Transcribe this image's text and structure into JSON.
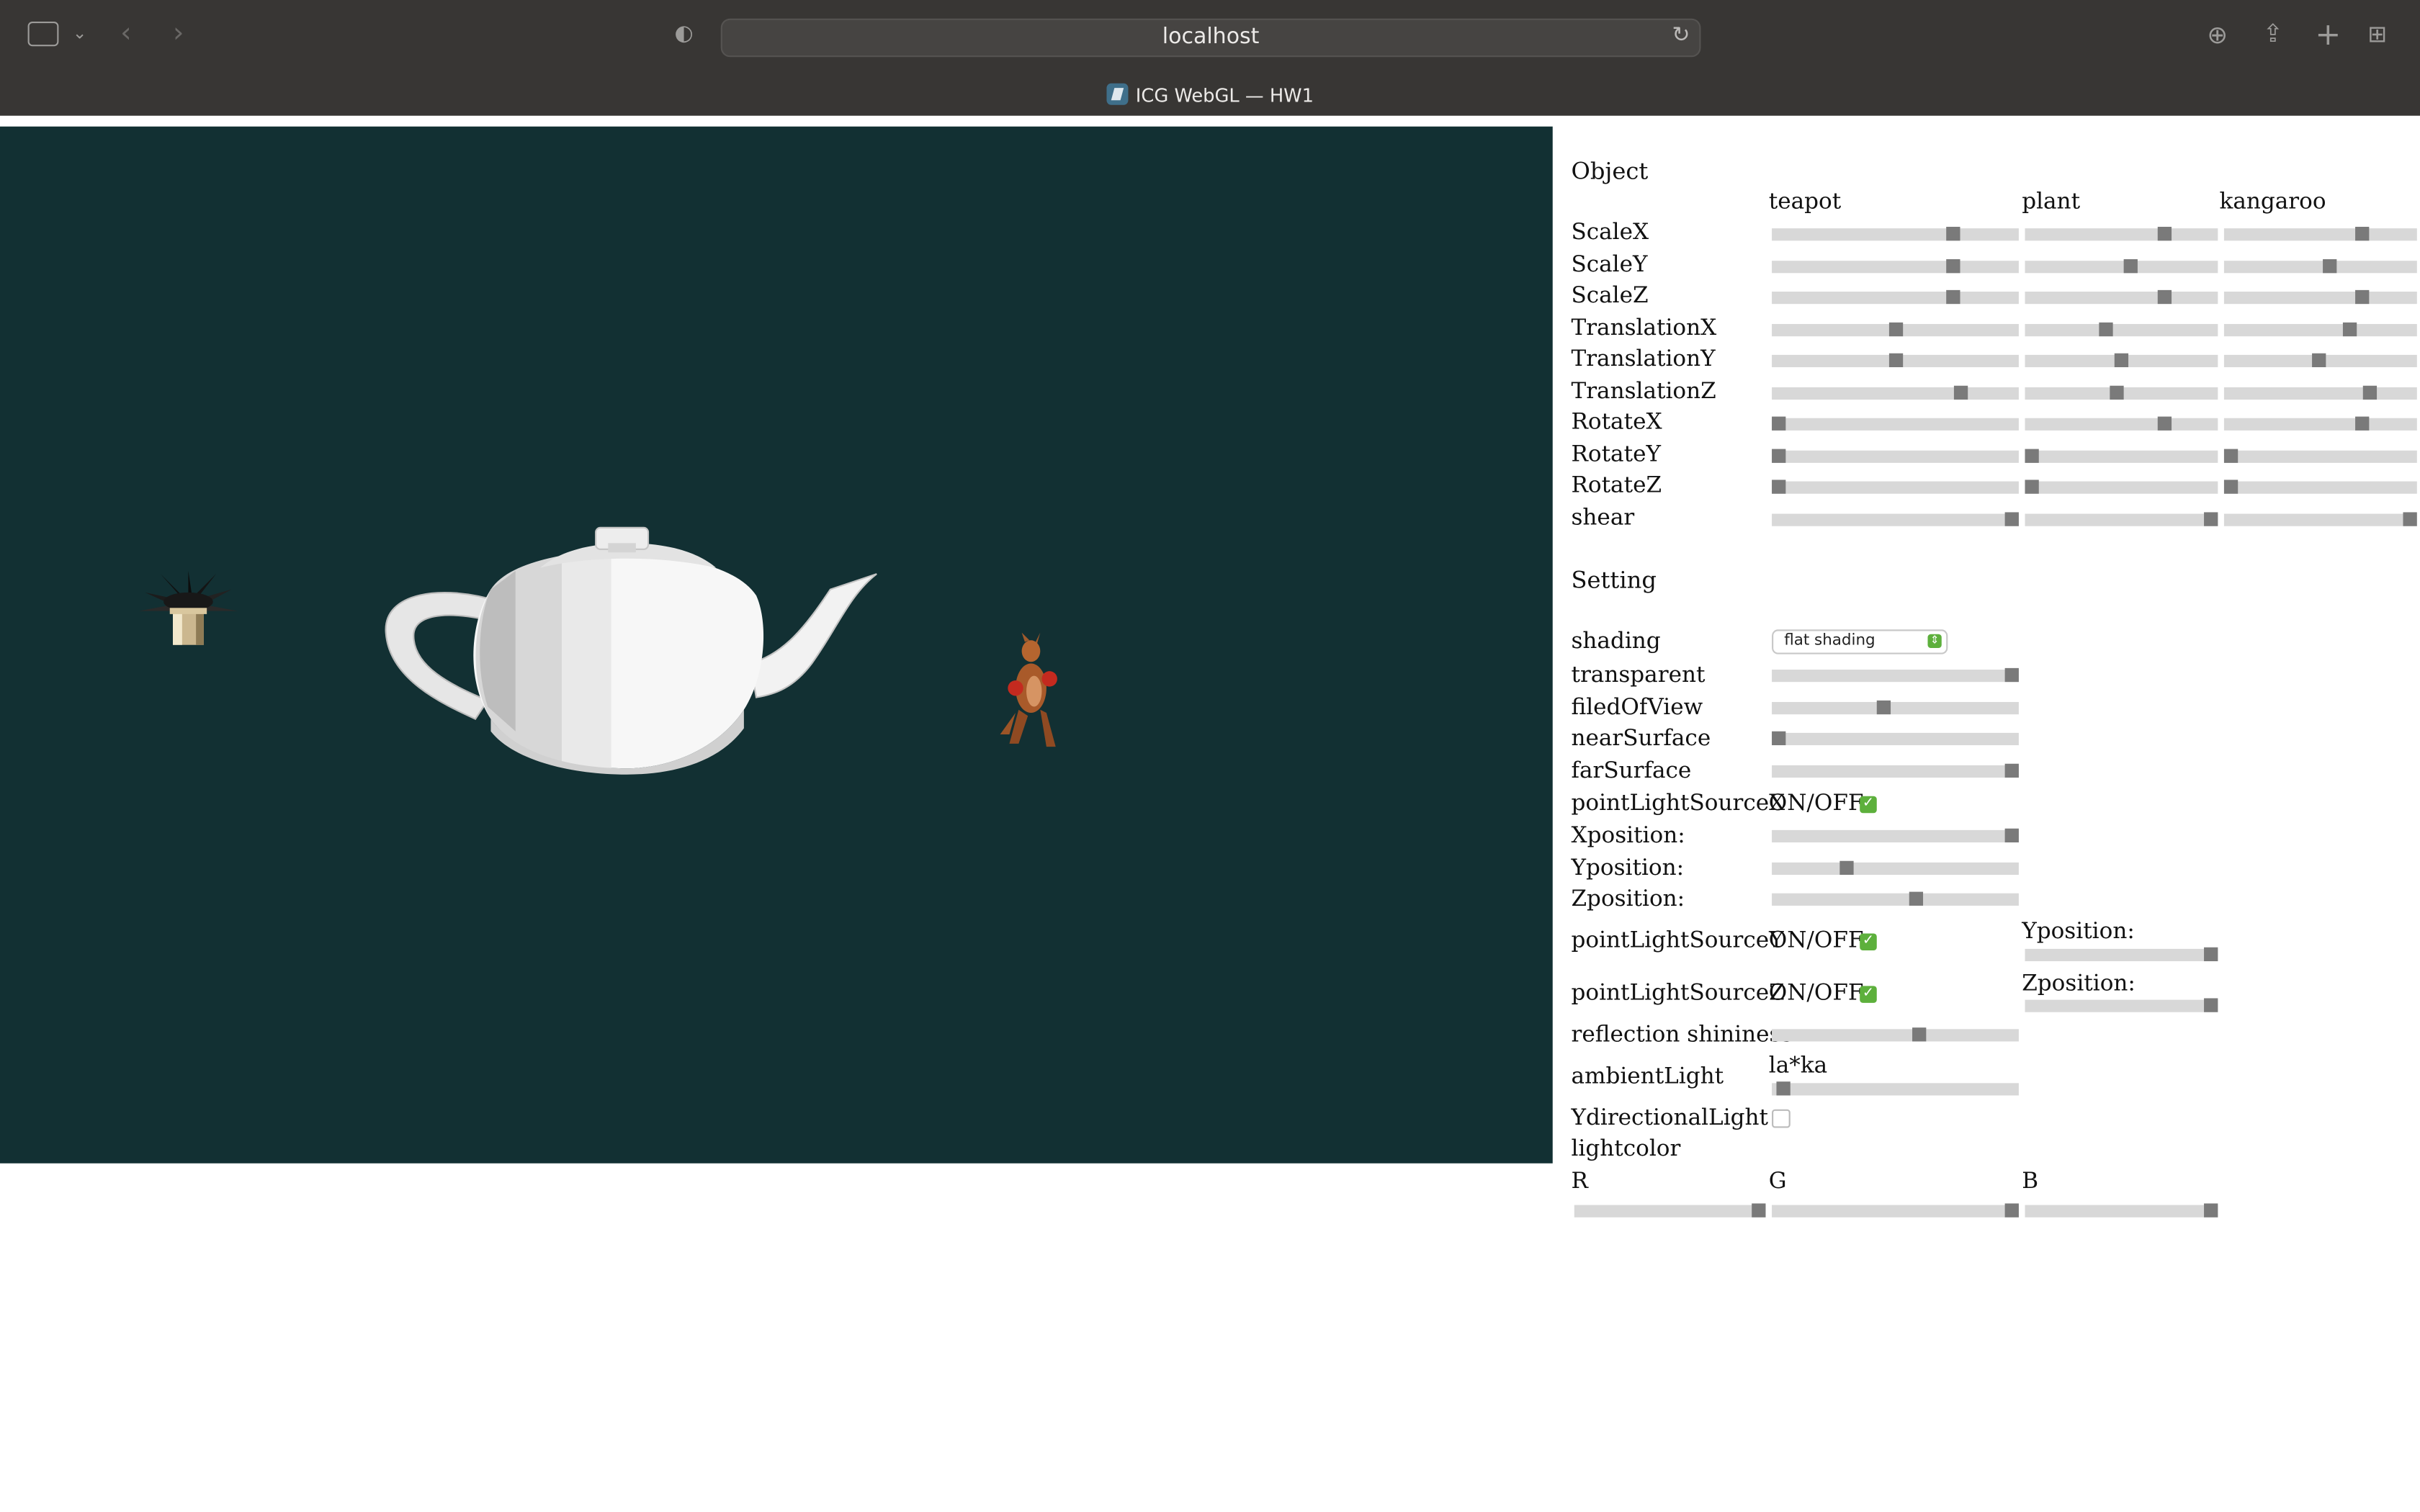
{
  "browser": {
    "url": "localhost",
    "tab_title": "ICG WebGL — HW1"
  },
  "canvas": {
    "background": "#123033",
    "objects": [
      "plant",
      "teapot",
      "kangaroo"
    ]
  },
  "object_section": {
    "title": "Object",
    "columns": [
      "teapot",
      "plant",
      "kangaroo"
    ],
    "rows": [
      {
        "label": "ScaleX",
        "values": [
          0.75,
          0.74,
          0.73
        ]
      },
      {
        "label": "ScaleY",
        "values": [
          0.75,
          0.55,
          0.55
        ]
      },
      {
        "label": "ScaleZ",
        "values": [
          0.75,
          0.74,
          0.73
        ]
      },
      {
        "label": "TranslationX",
        "values": [
          0.5,
          0.41,
          0.66
        ]
      },
      {
        "label": "TranslationY",
        "values": [
          0.5,
          0.5,
          0.49
        ]
      },
      {
        "label": "TranslationZ",
        "values": [
          0.78,
          0.47,
          0.78
        ]
      },
      {
        "label": "RotateX",
        "values": [
          0.0,
          0.74,
          0.73
        ]
      },
      {
        "label": "RotateY",
        "values": [
          0.0,
          0.0,
          0.0
        ]
      },
      {
        "label": "RotateZ",
        "values": [
          0.0,
          0.0,
          0.0
        ]
      },
      {
        "label": "shear",
        "values": [
          1.0,
          1.0,
          1.0
        ]
      }
    ]
  },
  "setting_section": {
    "title": "Setting",
    "shading_label": "shading",
    "shading_value": "flat shading",
    "transparent_label": "transparent",
    "transparent_value": 1.0,
    "fov_label": "filedOfView",
    "fov_value": 0.45,
    "near_label": "nearSurface",
    "near_value": 0.0,
    "far_label": "farSurface",
    "far_value": 1.0,
    "plx_label": "pointLightSourceX",
    "onoff": "ON/OFF",
    "xpos_label": "Xposition:",
    "xpos_value": 1.0,
    "ypos_label": "Yposition:",
    "ypos_value": 0.29,
    "zpos_label": "Zposition:",
    "zpos_value": 0.59,
    "ply_label": "pointLightSourceY",
    "ply_ypos_label": "Yposition:",
    "ply_ypos_value": 1.0,
    "plz_label": "pointLightSourceZ",
    "plz_zpos_label": "Zposition:",
    "plz_zpos_value": 1.0,
    "shininess_label": "reflection shininess",
    "shininess_value": 0.6,
    "ambient_label": "ambientLight",
    "ambient_sub": "la*ka",
    "ambient_value": 0.02,
    "ydir_label": "YdirectionalLight",
    "lightcolor_label": "lightcolor",
    "r_label": "R",
    "g_label": "G",
    "b_label": "B",
    "r_value": 1.0,
    "g_value": 1.0,
    "b_value": 1.0
  }
}
